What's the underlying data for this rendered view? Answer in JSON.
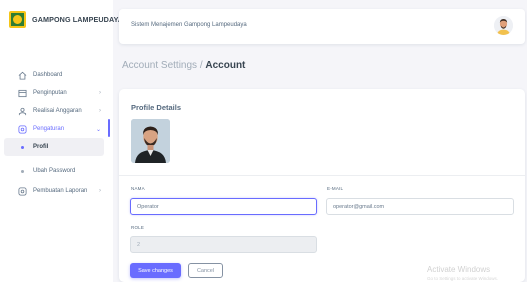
{
  "brand": {
    "name": "GAMPONG LAMPEUDAYA"
  },
  "navbar": {
    "title": "Sistem Menajemen Gampong Lampeudaya"
  },
  "sidebar": {
    "items": [
      {
        "label": "Dashboard",
        "icon": "home-icon"
      },
      {
        "label": "Penginputan",
        "icon": "layout-icon",
        "chevron": "›"
      },
      {
        "label": "Realisai Anggaran",
        "icon": "user-icon",
        "chevron": "›"
      },
      {
        "label": "Pengaturan",
        "icon": "settings-icon",
        "chevron": "⌄"
      },
      {
        "label": "Profil"
      },
      {
        "label": "Ubah Password"
      },
      {
        "label": "Pembuatan Laporan",
        "icon": "settings-icon",
        "chevron": "›"
      }
    ]
  },
  "page": {
    "breadcrumb": "Account Settings /",
    "title": "Account"
  },
  "card": {
    "title": "Profile Details",
    "fields": {
      "nama_label": "NAMA",
      "nama_value": "Operator",
      "email_label": "E-MAIL",
      "email_value": "operator@gmail.com",
      "role_label": "ROLE",
      "role_value": "2"
    },
    "buttons": {
      "save": "Save changes",
      "cancel": "Cancel"
    }
  },
  "watermark": {
    "title": "Activate Windows",
    "subtitle": "Go to Settings to activate Windows."
  },
  "colors": {
    "accent": "#696cff",
    "background": "#f5f5f9",
    "text": "#566a7f"
  }
}
